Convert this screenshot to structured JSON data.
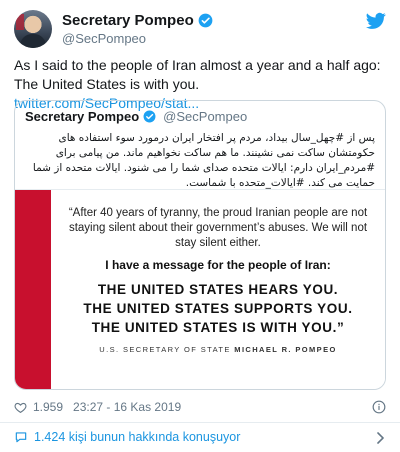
{
  "header": {
    "name": "Secretary Pompeo",
    "handle": "@SecPompeo",
    "icons": {
      "verified": "verified-badge-icon",
      "platform": "twitter-bird-icon"
    }
  },
  "tweet": {
    "text": "As I said to the people of Iran almost a year and a half ago: The United States is with you.",
    "link": "twitter.com/SecPompeo/stat..."
  },
  "quoted": {
    "name": "Secretary Pompeo",
    "handle": "@SecPompeo",
    "text": "پس از #چهل_سال بیداد، مردم پر افتخار ایران درمورد سوء استفاده های حکومتشان ساکت نمی نشینند. ما هم ساکت نخواهیم ماند. من پیامی برای #مردم_ایران دارم: ایالات متحده صدای شما را می شنود. ایالات متحده از شما حمایت می کند. #ایالات_متحده با شماست.",
    "image": {
      "quote": "“After 40 years of tyranny, the proud Iranian people are not staying silent about their government’s abuses. We will not stay silent either.",
      "lead": "I have a message for the people of Iran:",
      "line1": "THE UNITED STATES HEARS YOU.",
      "line2": "THE UNITED STATES SUPPORTS YOU.",
      "line3": "THE UNITED STATES IS WITH YOU.”",
      "sig_prefix": "U.S. SECRETARY OF STATE",
      "sig_name": "MICHAEL R. POMPEO",
      "accent_color": "#c8102e"
    }
  },
  "meta": {
    "likes": "1.959",
    "timestamp": "23:27 - 16 Kas 2019"
  },
  "footer": {
    "discussion": "1.424 kişi bunun hakkında konuşuyor"
  },
  "colors": {
    "link": "#1b95e0",
    "muted": "#657786",
    "border": "#ccd6dd",
    "heart": "#e0245e"
  }
}
